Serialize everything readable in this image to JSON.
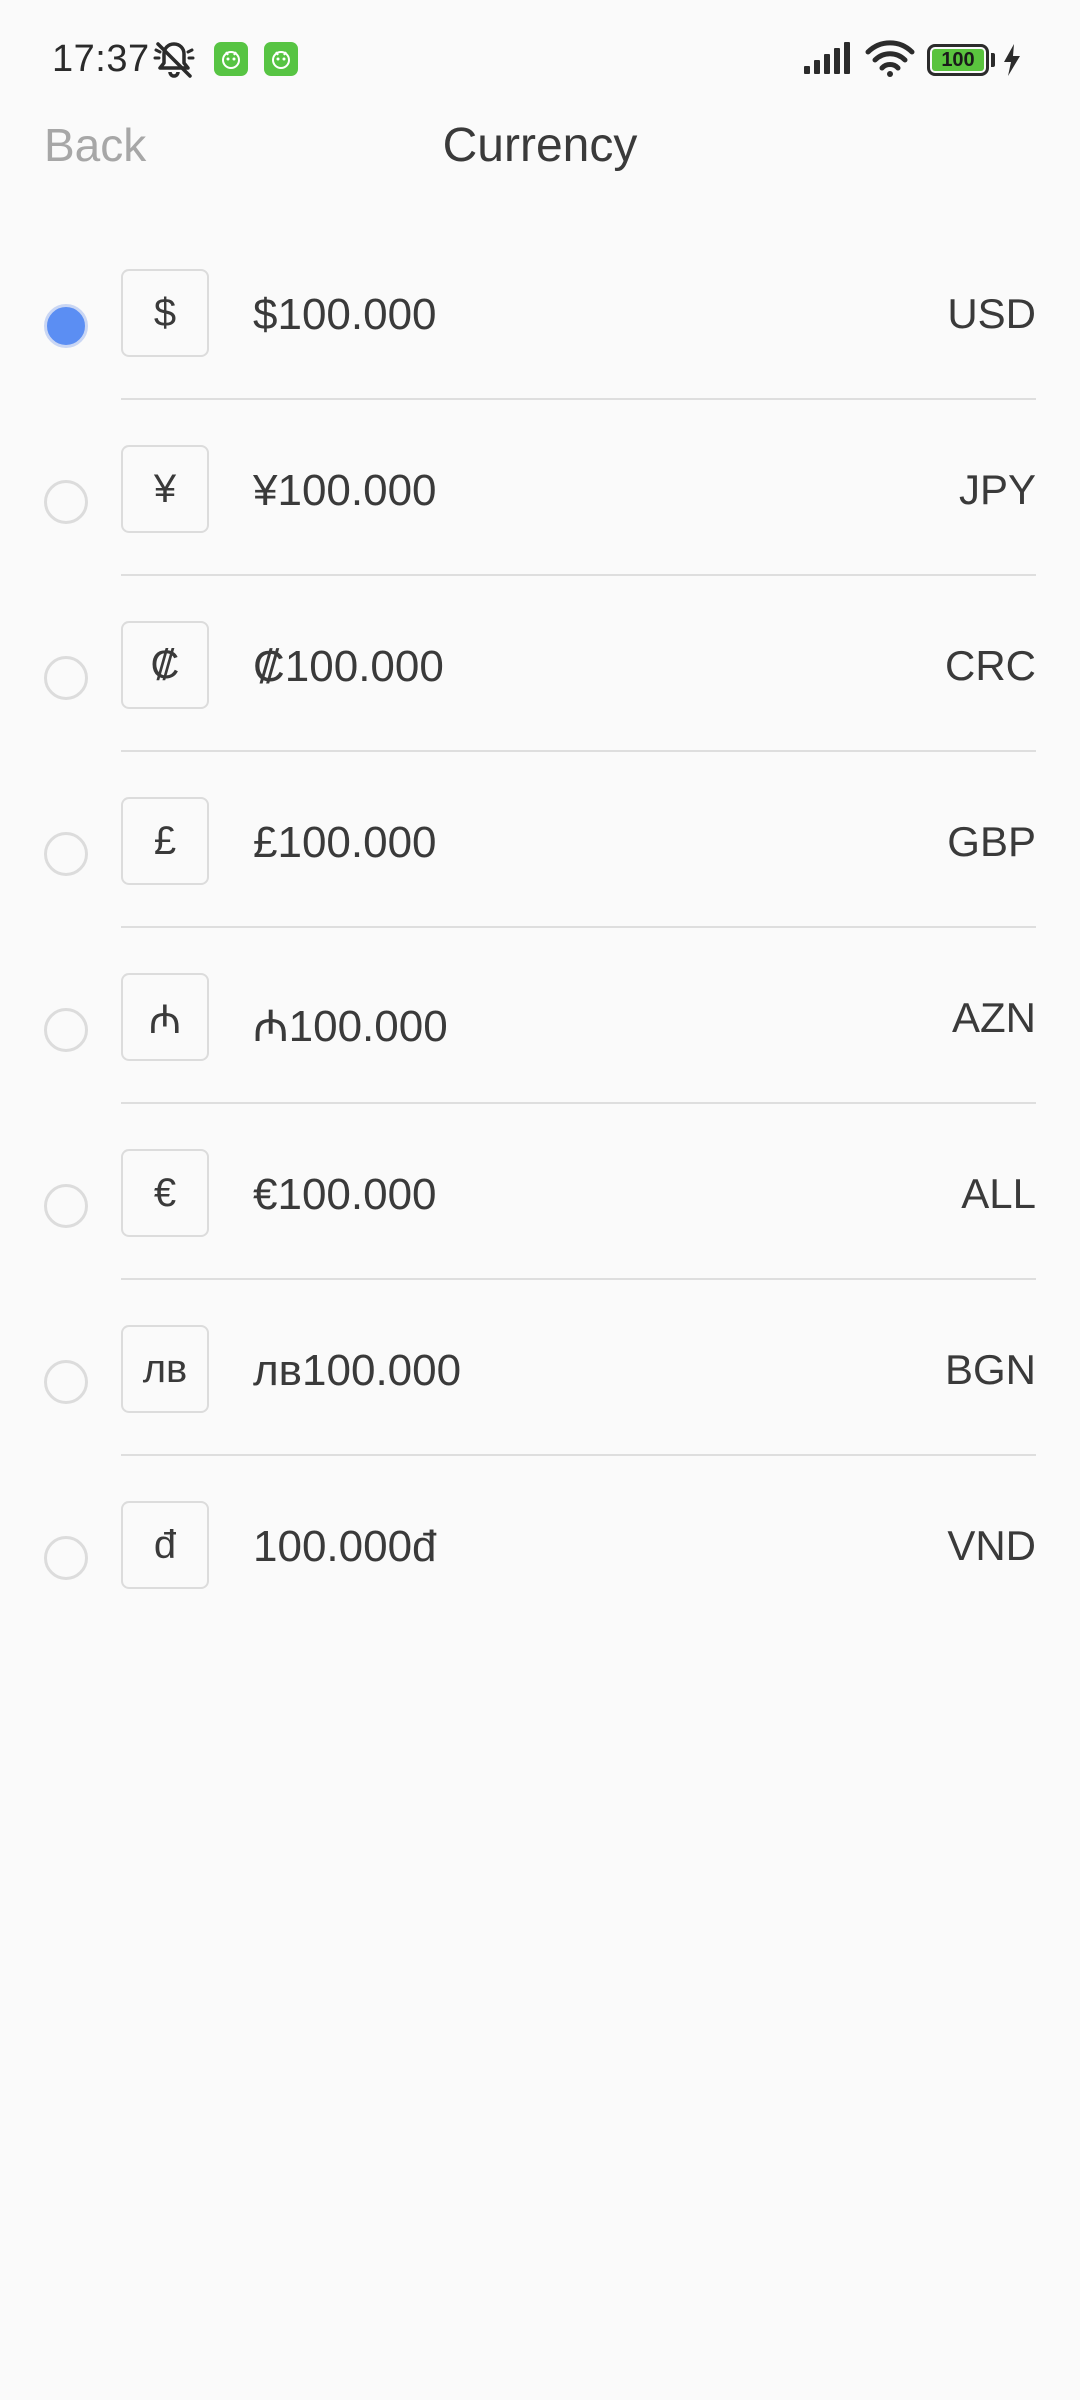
{
  "status_bar": {
    "time": "17:37",
    "battery": "100",
    "accent_color": "#57c443"
  },
  "header": {
    "back_label": "Back",
    "title": "Currency"
  },
  "currencies": [
    {
      "symbol": "$",
      "amount": "$100.000",
      "code": "USD",
      "selected": true
    },
    {
      "symbol": "¥",
      "amount": "¥100.000",
      "code": "JPY",
      "selected": false
    },
    {
      "symbol": "₡",
      "amount": "₡100.000",
      "code": "CRC",
      "selected": false
    },
    {
      "symbol": "£",
      "amount": "£100.000",
      "code": "GBP",
      "selected": false
    },
    {
      "symbol": "₼",
      "amount": "₼100.000",
      "code": "AZN",
      "selected": false
    },
    {
      "symbol": "€",
      "amount": "€100.000",
      "code": "ALL",
      "selected": false
    },
    {
      "symbol": "лв",
      "amount": "лв100.000",
      "code": "BGN",
      "selected": false
    },
    {
      "symbol": "đ",
      "amount": "100.000đ",
      "code": "VND",
      "selected": false
    }
  ],
  "colors": {
    "selected_radio": "#5b8ef3",
    "divider": "#dedede"
  }
}
